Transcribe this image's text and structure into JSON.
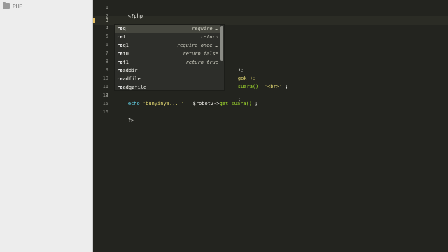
{
  "sidebar": {
    "folder": {
      "label": "PHP",
      "icon": "folder-icon"
    }
  },
  "gutter": {
    "lines": [
      "1",
      "2",
      "3",
      "4",
      "5",
      "6",
      "7",
      "8",
      "9",
      "10",
      "11",
      "12",
      "13",
      "14",
      "15",
      "16"
    ]
  },
  "code": {
    "line1": "<?php",
    "line3_typed": "re",
    "line8_tail": ");",
    "line9_tail": "gok');",
    "line10_fn": "suara()",
    "line10_str": "'<br>'",
    "line10_end": ";",
    "line13_tail": ";",
    "line14_echo": "echo",
    "line14_str": "'bunyinya... '",
    "line14_var": "$robot2",
    "line14_arrow": "->",
    "line14_fn": "get_suara()",
    "line14_end": ";",
    "line16": "?>"
  },
  "autocomplete": {
    "items": [
      {
        "trigger_bold": "re",
        "trigger_rest": "q",
        "hint": "require …"
      },
      {
        "trigger_bold": "re",
        "trigger_rest": "t",
        "hint": "return"
      },
      {
        "trigger_bold": "re",
        "trigger_rest": "q1",
        "hint": "require_once …"
      },
      {
        "trigger_bold": "re",
        "trigger_rest": "t0",
        "hint": "return false"
      },
      {
        "trigger_bold": "re",
        "trigger_rest": "t1",
        "hint": "return true"
      },
      {
        "trigger_bold": "re",
        "trigger_rest": "addir",
        "hint": ""
      },
      {
        "trigger_bold": "re",
        "trigger_rest": "adfile",
        "hint": ""
      },
      {
        "trigger_bold": "re",
        "trigger_rest": "adgzfile",
        "hint": ""
      }
    ],
    "selected_index": 0
  },
  "colors": {
    "editor_bg": "#23241f",
    "string": "#e6db74",
    "keyword": "#66d9ef",
    "function": "#a6e22e",
    "popup_bg": "#2d2e2a",
    "popup_selected": "#46473f"
  }
}
